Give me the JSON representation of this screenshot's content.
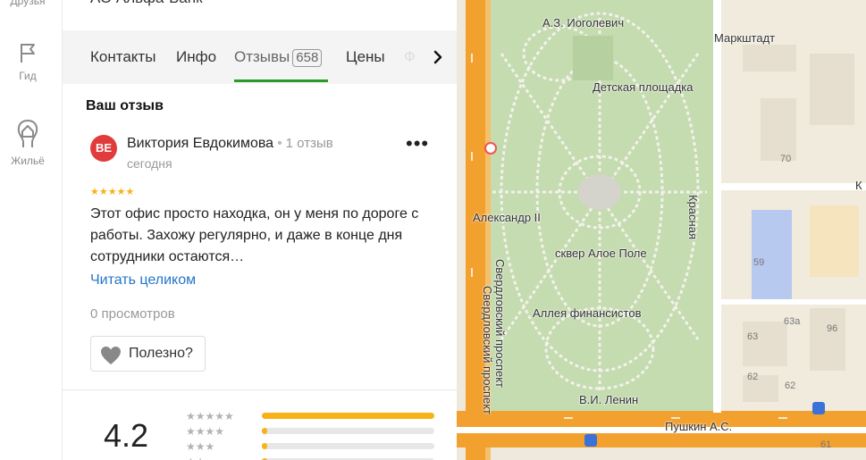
{
  "rail": {
    "friends_label": "Друзья",
    "guide_label": "Гид",
    "housing_label": "Жильё"
  },
  "org": {
    "title": "АО Альфа-Банк"
  },
  "tabs": [
    {
      "label": "Контакты"
    },
    {
      "label": "Инфо"
    },
    {
      "label": "Отзывы",
      "count": "658"
    },
    {
      "label": "Цены"
    },
    {
      "label": "Ф"
    }
  ],
  "review": {
    "section_title": "Ваш отзыв",
    "avatar_initials": "ВЕ",
    "author": "Виктория Евдокимова",
    "author_reviews": "1 отзыв",
    "date": "сегодня",
    "rating": 5,
    "stars": "★★★★★",
    "text": "Этот офис просто находка, он у меня по дороге с работы. Захожу регулярно, и даже в конце дня сотрудники остаются…",
    "read_more": "Читать целиком",
    "views": "0 просмотров",
    "useful_label": "Полезно?",
    "more_glyph": "•••"
  },
  "summary": {
    "rating": "4.2",
    "distribution": [
      {
        "stars": "★★★★★",
        "fraction": 1.0
      },
      {
        "stars": "★★★★",
        "fraction": 0.03
      },
      {
        "stars": "★★★",
        "fraction": 0.03
      },
      {
        "stars": "★★",
        "fraction": 0.03
      }
    ]
  },
  "map": {
    "labels": {
      "iogolevich": "А.З. Иоголевич",
      "playground": "Детская площадка",
      "alexander": "Александр II",
      "square": "сквер Алое Поле",
      "alley": "Аллея финансистов",
      "lenin": "В.И. Ленин",
      "pushkin": "Пушкин А.С.",
      "markstadt": "Маркштадт",
      "krasnaya": "Красная",
      "sverdlovsky_1": "Свердловский проспект",
      "sverdlovsky_2": "Свердловский проспект",
      "k_letter": "К"
    },
    "house_numbers": [
      "70",
      "59",
      "63а",
      "96",
      "63",
      "62",
      "61",
      "62"
    ]
  },
  "colors": {
    "accent_green": "#2a9a2a",
    "star_yellow": "#f7b21a",
    "link_blue": "#2376c9",
    "avatar_red": "#e23b3b",
    "road_orange": "#f2a02e",
    "park_green": "#c5dbb0"
  },
  "icons": {
    "guide": "flag-icon",
    "housing": "house-icon",
    "next": "chevron-right-icon",
    "useful": "heart-icon"
  }
}
